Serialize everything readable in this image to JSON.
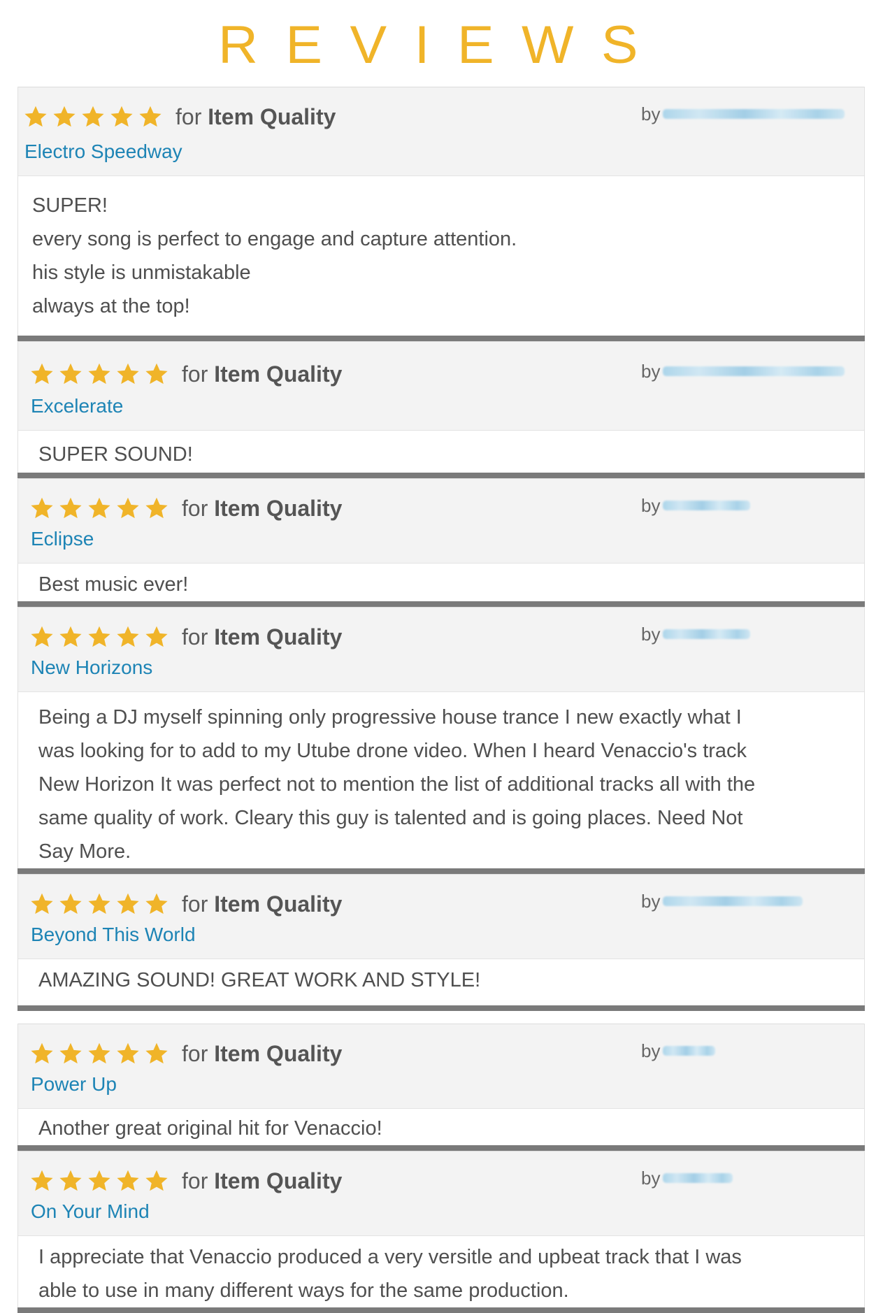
{
  "page": {
    "title": "REVIEWS",
    "accent_color": "#f0b429",
    "link_color": "#1d84b5",
    "star_icon": "star-icon",
    "star_count": 5
  },
  "reviews": [
    {
      "rating": 5,
      "for_prefix": "for",
      "category": "Item Quality",
      "track": "Electro Speedway",
      "by_label": "by",
      "body_lines": [
        "SUPER!",
        "every song is perfect to engage and capture attention.",
        "his style is unmistakable",
        "always at the top!"
      ]
    },
    {
      "rating": 5,
      "for_prefix": "for",
      "category": "Item Quality",
      "track": "Excelerate",
      "by_label": "by",
      "body_lines": [
        "SUPER SOUND!"
      ]
    },
    {
      "rating": 5,
      "for_prefix": "for",
      "category": "Item Quality",
      "track": "Eclipse",
      "by_label": "by",
      "body_lines": [
        "Best music ever!"
      ]
    },
    {
      "rating": 5,
      "for_prefix": "for",
      "category": "Item Quality",
      "track": "New Horizons",
      "by_label": "by",
      "body_lines": [
        "Being a DJ myself spinning only progressive house trance I new exactly what I",
        "was looking for to add to my Utube drone video. When I heard Venaccio's track",
        "New Horizon It was perfect not to mention the list of additional tracks all with the",
        "same quality of work. Cleary this guy is talented and is going places. Need Not",
        "Say More."
      ]
    },
    {
      "rating": 5,
      "for_prefix": "for",
      "category": "Item Quality",
      "track": "Beyond This World",
      "by_label": "by",
      "body_lines": [
        "AMAZING SOUND! GREAT WORK AND STYLE!"
      ]
    },
    {
      "rating": 5,
      "for_prefix": "for",
      "category": "Item Quality",
      "track": "Power Up",
      "by_label": "by",
      "body_lines": [
        "Another great original hit for Venaccio!"
      ]
    },
    {
      "rating": 5,
      "for_prefix": "for",
      "category": "Item Quality",
      "track": "On Your Mind",
      "by_label": "by",
      "body_lines": [
        "I appreciate that Venaccio produced a very versitle and upbeat track that I was",
        "able to use in many different ways for the same production."
      ]
    }
  ]
}
